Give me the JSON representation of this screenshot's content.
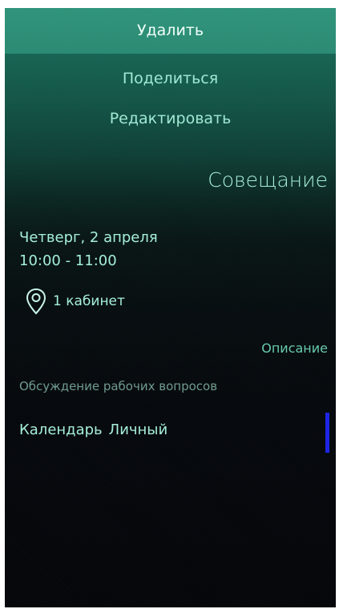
{
  "menu": {
    "delete_label": "Удалить",
    "share_label": "Поделиться",
    "edit_label": "Редактировать"
  },
  "event": {
    "title": "Совещание",
    "date": "Четверг, 2 апреля",
    "time": "10:00 - 11:00",
    "location": "1 кабинет",
    "description_header": "Описание",
    "description": "Обсуждение рабочих вопросов",
    "calendar_label": "Календарь",
    "calendar_name": "Личный",
    "calendar_color": "#1b24e6"
  },
  "icons": {
    "location": "map-pin-icon"
  },
  "colors": {
    "accent": "#a5efd9",
    "highlight": "#2f9a7d",
    "background": "#04060a"
  }
}
